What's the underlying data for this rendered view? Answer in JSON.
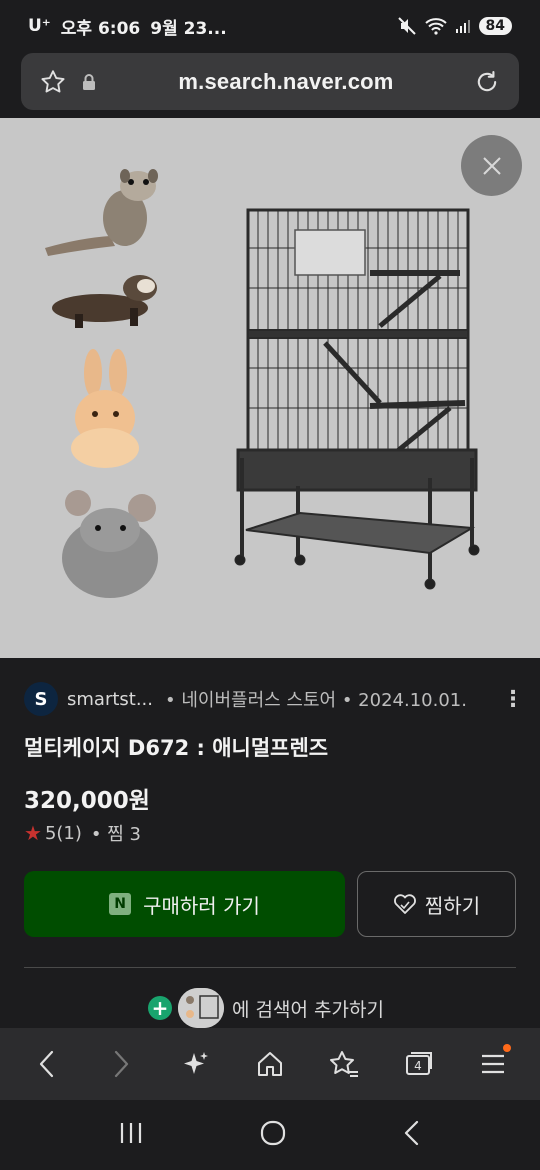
{
  "status_bar": {
    "carrier": "U⁺",
    "time": "오후 6:06",
    "date": "9월 23...",
    "battery": "84"
  },
  "browser": {
    "url": "m.search.naver.com",
    "tab_count": "4"
  },
  "product": {
    "seller_initial": "S",
    "seller_name": "smartst...",
    "seller_meta": "• 네이버플러스 스토어 • 2024.10.01.",
    "title": "멀티케이지 D672 : 애니멀프렌즈",
    "price": "320,000원",
    "rating": "5(1)",
    "zzim_count": "• 찜 3",
    "buy_label": "구매하러 가기",
    "buy_logo": "N",
    "zzim_label": "찜하기",
    "add_keyword_label": "에 검색어 추가하기"
  },
  "colors": {
    "buy_button": "#004d00",
    "star": "#c8322f",
    "plus": "#19a46e",
    "badge": "#ff6a1a"
  },
  "icons": [
    "star-icon",
    "lock-icon",
    "refresh-icon",
    "close-icon",
    "heart-icon",
    "back-icon",
    "forward-icon",
    "sparkle-icon",
    "home-icon",
    "bookmark-star-icon",
    "tabs-icon",
    "menu-icon"
  ]
}
